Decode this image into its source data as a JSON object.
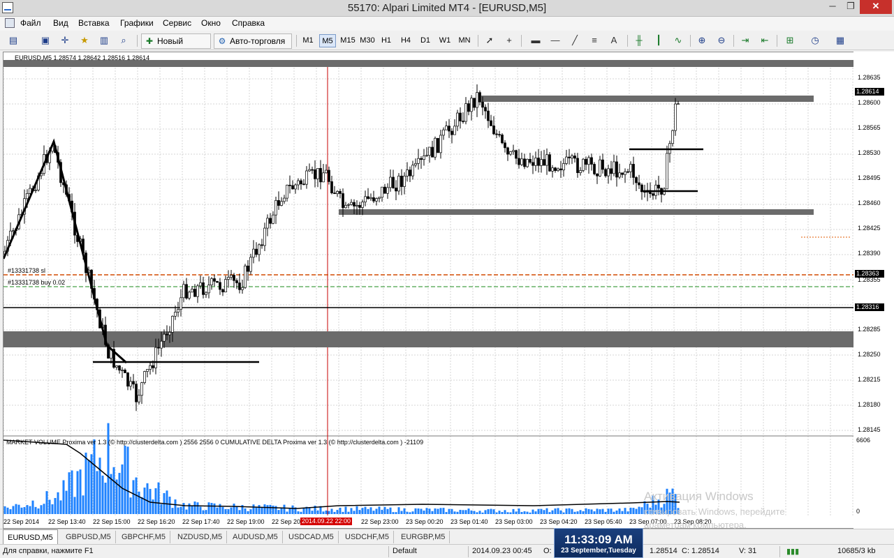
{
  "window": {
    "title": "55170: Alpari Limited MT4 - [EURUSD,M5]",
    "buttons": {
      "minimize": "─",
      "restore": "❐",
      "close": "✕"
    }
  },
  "menu": [
    "Файл",
    "Вид",
    "Вставка",
    "Графики",
    "Сервис",
    "Окно",
    "Справка"
  ],
  "toolbar": {
    "new_order": "Новый Ордер",
    "autotrading": "Авто-торговля",
    "timeframes": [
      "M1",
      "M5",
      "M15",
      "M30",
      "H1",
      "H4",
      "D1",
      "W1",
      "MN"
    ],
    "active_timeframe": "M5",
    "text_tool": "A"
  },
  "chart": {
    "symbol_info": "EURUSD,M5  1.28574 1.28642 1.28516 1.28614",
    "price_ticks": [
      "1.28635",
      "1.28600",
      "1.28565",
      "1.28530",
      "1.28495",
      "1.28460",
      "1.28425",
      "1.28390",
      "1.28355",
      "1.28320",
      "1.28285",
      "1.28250",
      "1.28215",
      "1.28180",
      "1.28145"
    ],
    "current_price": "1.28614",
    "order_sl_price": "1.28363",
    "line_price": "1.28316",
    "order_sl_label": "#13331738 sl",
    "order_buy_label": "#13331738 buy 0.02",
    "indicator_info": "MARKET VOLUME Proxima ver 1.3 (© http://clusterdelta.com ) 2556 2556 0  CUMULATIVE DELTA Proxima ver 1.3 (© http://clusterdelta.com ) -21109",
    "volume_max": "6606",
    "volume_zero": "0",
    "time_labels": [
      "22 Sep 2014",
      "22 Sep 13:40",
      "22 Sep 15:00",
      "22 Sep 16:20",
      "22 Sep 17:40",
      "22 Sep 19:00",
      "22 Sep 20",
      "22 Sep 23:00",
      "23 Sep 00:20",
      "23 Sep 01:40",
      "23 Sep 03:00",
      "23 Sep 04:20",
      "23 Sep 05:40",
      "23 Sep 07:00",
      "23 Sep 08:20"
    ],
    "cursor_time": "2014.09.22 22:00",
    "colors": {
      "level_band": "#6b6b6b",
      "volume": "#1e82ff",
      "cursor": "#c80000",
      "stop_loss": "#d24a00",
      "buy": "#1a8a1a"
    }
  },
  "watermark": {
    "line1": "Активация Windows",
    "line2": "ктивировать Windows, перейдите",
    "line3": "араметрам компьютера."
  },
  "tabs": [
    "EURUSD,M5",
    "GBPUSD,M5",
    "GBPCHF,M5",
    "NZDUSD,M5",
    "AUDUSD,M5",
    "USDCAD,M5",
    "USDCHF,M5",
    "EURGBP,M5"
  ],
  "active_tab": "EURUSD,M5",
  "status": {
    "help": "Для справки, нажмите F1",
    "profile": "Default",
    "datetime": "2014.09.23 00:45",
    "open": "O:",
    "low": "1.28514",
    "close": "C: 1.28514",
    "volume": "V: 31",
    "traffic": "10685/3 kb"
  },
  "clock": {
    "time": "11:33:09 AM",
    "date": "23 September,Tuesday"
  }
}
